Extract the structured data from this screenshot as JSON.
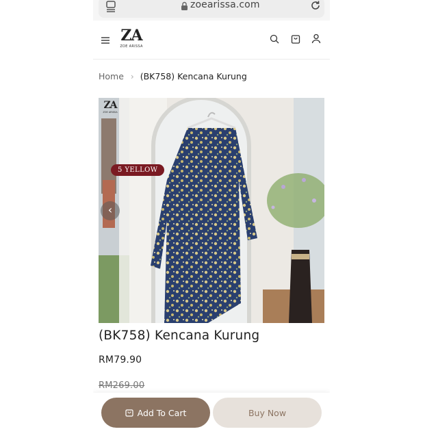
{
  "browser": {
    "url": "zoearissa.com",
    "icons": [
      "tabs-icon",
      "lock-icon",
      "reload-icon"
    ]
  },
  "header": {
    "logo_mark": "ZA",
    "logo_text": "ZOE ARISSA",
    "icons": [
      "menu-icon",
      "search-icon",
      "bag-icon",
      "user-icon"
    ]
  },
  "breadcrumb": {
    "home": "Home",
    "current": "(BK758) Kencana Kurung"
  },
  "image": {
    "badge": "5 YELLOW",
    "logo_mark": "ZA",
    "logo_text": "ZOE ARISSA",
    "prev_arrow": "‹"
  },
  "product": {
    "title": "(BK758) Kencana Kurung",
    "price": "RM79.90",
    "original_price": "RM269.00"
  },
  "actions": {
    "add_to_cart": "Add To Cart",
    "buy_now": "Buy Now"
  },
  "colors": {
    "primary_button": "#8c7462",
    "secondary_button": "#e7e1db",
    "badge": "#7a1a22"
  }
}
